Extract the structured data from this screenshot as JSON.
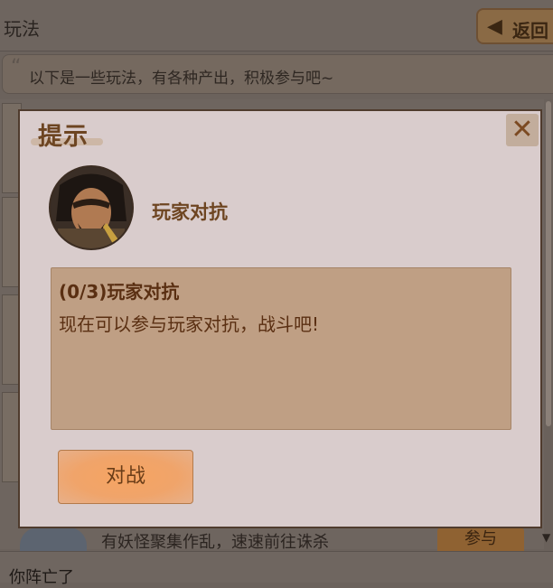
{
  "header": {
    "title": "玩法",
    "back_label": "返回"
  },
  "notice": {
    "text": "以下是一些玩法，有各种产出，积极参与吧~"
  },
  "background_row": {
    "text": "有妖怪聚集作乱，速速前往诛杀",
    "button_label": "参与"
  },
  "bottom_bar": {
    "text": "你阵亡了"
  },
  "dialog": {
    "title": "提示",
    "close_icon": "close-icon",
    "player_name": "玩家对抗",
    "desc_title": "(0/3)玩家对抗",
    "desc_text": "现在可以参与玩家对抗，战斗吧!",
    "fight_label": "对战"
  },
  "colors": {
    "dialog_bg": "#d9cccc",
    "desc_bg": "#bf9f84",
    "button_orange": "#f0a46a",
    "title_brown": "#6d4522"
  }
}
